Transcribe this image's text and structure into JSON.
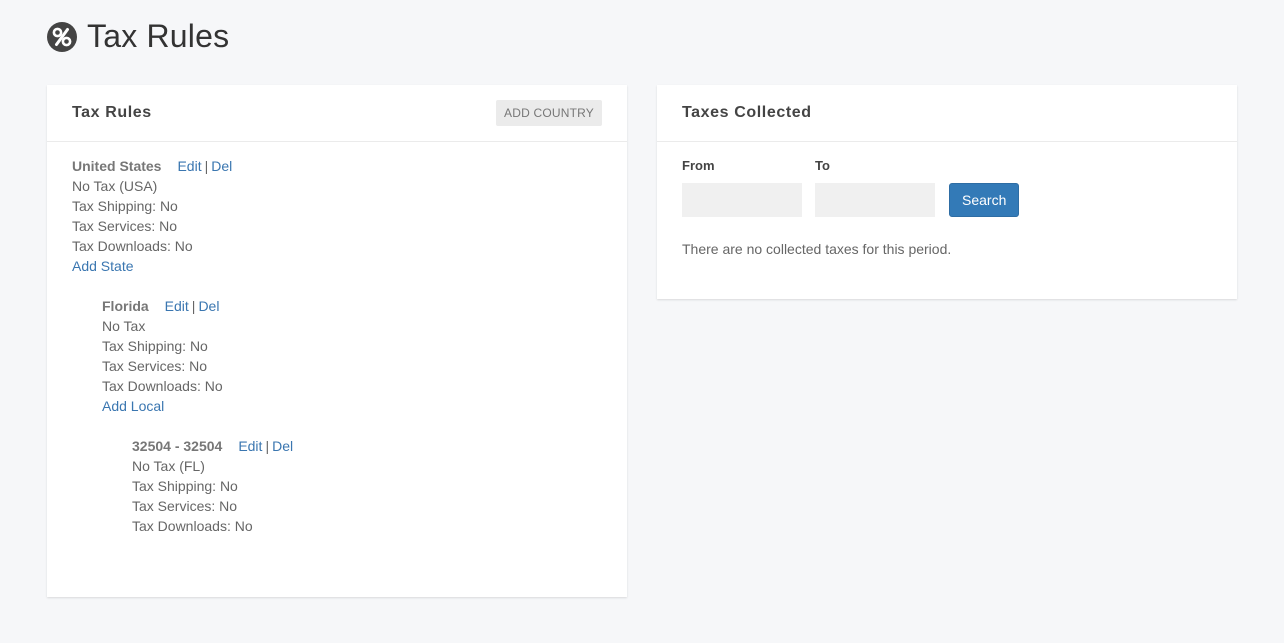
{
  "page": {
    "title": "Tax Rules",
    "icon": "percent-icon"
  },
  "tax_rules_card": {
    "title": "Tax Rules",
    "add_country_label": "ADD COUNTRY",
    "country": {
      "name": "United States",
      "edit_label": "Edit",
      "del_label": "Del",
      "lines": [
        "No Tax (USA)",
        "Tax Shipping: No",
        "Tax Services: No",
        "Tax Downloads: No"
      ],
      "add_label": "Add State"
    },
    "state": {
      "name": "Florida",
      "edit_label": "Edit",
      "del_label": "Del",
      "lines": [
        "No Tax",
        "Tax Shipping: No",
        "Tax Services: No",
        "Tax Downloads: No"
      ],
      "add_label": "Add Local"
    },
    "local": {
      "name": "32504 - 32504",
      "edit_label": "Edit",
      "del_label": "Del",
      "lines": [
        "No Tax (FL)",
        "Tax Shipping: No",
        "Tax Services: No",
        "Tax Downloads: No"
      ]
    },
    "separator": "|"
  },
  "taxes_collected_card": {
    "title": "Taxes Collected",
    "from_label": "From",
    "from_value": "",
    "to_label": "To",
    "to_value": "",
    "search_label": "Search",
    "empty_message": "There are no collected taxes for this period."
  },
  "colors": {
    "link": "#3a76b0",
    "primary_button": "#337ab7",
    "background": "#f6f7f9"
  }
}
